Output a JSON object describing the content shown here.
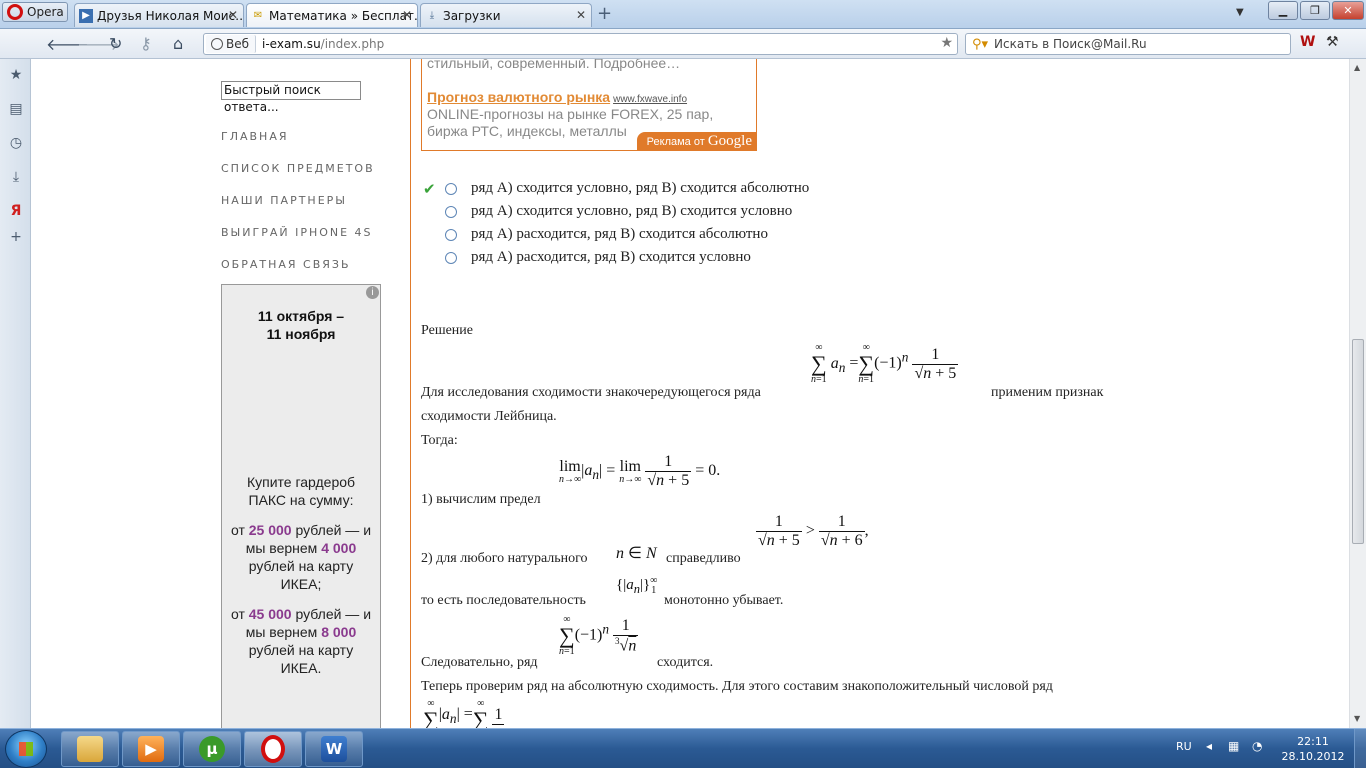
{
  "browser": {
    "menu_label": "Opera",
    "tabs": [
      {
        "label": "Друзья Николая Моис…"
      },
      {
        "label": "Математика » Бесплат…"
      },
      {
        "label": "Загрузки"
      }
    ],
    "address": {
      "badge": "Веб",
      "url_host": "i-exam.su",
      "url_path": "/index.php"
    },
    "search_placeholder": "Искать в Поиск@Mail.Ru"
  },
  "sidebar": {
    "quick_search": "Быстрый поиск ответа...",
    "menu": [
      {
        "label": "ГЛАВНАЯ"
      },
      {
        "label": "СПИСОК ПРЕДМЕТОВ"
      },
      {
        "label": "НАШИ ПАРТНЕРЫ"
      },
      {
        "label": "ВЫИГРАЙ IPHONE 4S"
      },
      {
        "label": "ОБРАТНАЯ СВЯЗЬ"
      }
    ],
    "promo": {
      "dates_line1": "11 октября –",
      "dates_line2": "11 ноября",
      "buy": "Купите гардероб ПАКС на сумму:",
      "offer1_pre": "от ",
      "offer1_amount": "25 000",
      "offer1_mid": " рублей — и мы вернем ",
      "offer1_back": "4 000",
      "offer1_post": " рублей на карту ИКЕА;",
      "offer2_pre": "от ",
      "offer2_amount": "45 000",
      "offer2_mid": " рублей — и мы вернем ",
      "offer2_back": "8 000",
      "offer2_post": " рублей на карту ИКЕА."
    }
  },
  "ad": {
    "prev_text": "стильный, современный. Подробнее…",
    "title": "Прогноз валютного рынка",
    "domain": "www.fxwave.info",
    "desc": "ONLINE-прогнозы на рынке FOREX, 25 пар, биржа РТС, индексы, металлы",
    "by": "Реклама от",
    "google": "Google"
  },
  "answers": [
    {
      "text": "ряд А) сходится условно, ряд В) сходится абсолютно",
      "correct": true
    },
    {
      "text": "ряд А) сходится условно, ряд В) сходится условно",
      "correct": false
    },
    {
      "text": "ряд А) расходится, ряд В) сходится абсолютно",
      "correct": false
    },
    {
      "text": "ряд А) расходится, ряд В) сходится условно",
      "correct": false
    }
  ],
  "solution": {
    "heading": "Решение",
    "p1_pre": "Для исследования сходимости знакочередующегося ряда",
    "p1_post": "применим признак",
    "p1_line2": "сходимости Лейбница.",
    "then": "Тогда:",
    "step1": "1) вычислим предел",
    "step2_pre": "2) для любого натурального",
    "step2_mid": "справедливо",
    "step3_pre": "то есть последовательность",
    "step3_post": "монотонно убывает.",
    "conc_pre": "Следовательно, ряд",
    "conc_post": "сходится.",
    "abs_check": "Теперь проверим ряд на абсолютную сходимость. Для этого составим знакоположительный числовой ряд"
  },
  "taskbar": {
    "lang": "RU",
    "time": "22:11",
    "date": "28.10.2012"
  }
}
